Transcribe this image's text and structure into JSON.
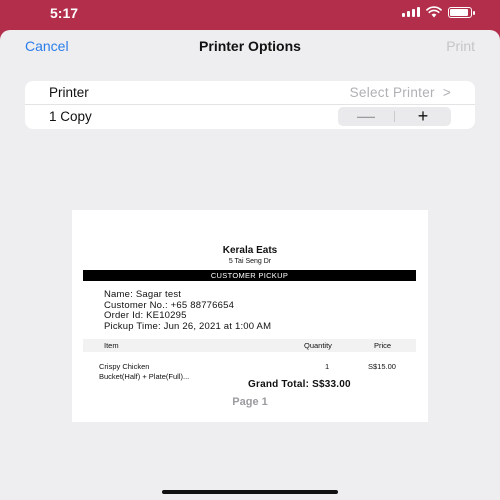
{
  "status_bar": {
    "time": "5:17",
    "battery_level": 0.9
  },
  "nav": {
    "cancel_label": "Cancel",
    "title": "Printer Options",
    "print_label": "Print"
  },
  "options": {
    "printer_label": "Printer",
    "printer_value": "Select Printer",
    "printer_chevron": ">",
    "copies_label": "1 Copy",
    "minus_glyph": "—",
    "plus_glyph": "+"
  },
  "receipt": {
    "shop_name": "Kerala Eats",
    "shop_address": "5 Tai Seng Dr",
    "pickup_banner": "CUSTOMER PICKUP",
    "name_line": "Name: Sagar test",
    "customer_no_line": "Customer No.: +65 88776654",
    "order_id_line": "Order Id: KE10295",
    "pickup_time_line": "Pickup Time: Jun 26, 2021 at 1:00 AM",
    "columns": {
      "item": "Item",
      "quantity": "Quantity",
      "price": "Price"
    },
    "items": [
      {
        "name_line1": "Crispy Chicken",
        "name_line2": "Bucket(Half) + Plate(Full)...",
        "quantity": "1",
        "price": "S$15.00"
      }
    ],
    "grand_total": "Grand Total:  S$33.00",
    "page_label": "Page 1"
  }
}
